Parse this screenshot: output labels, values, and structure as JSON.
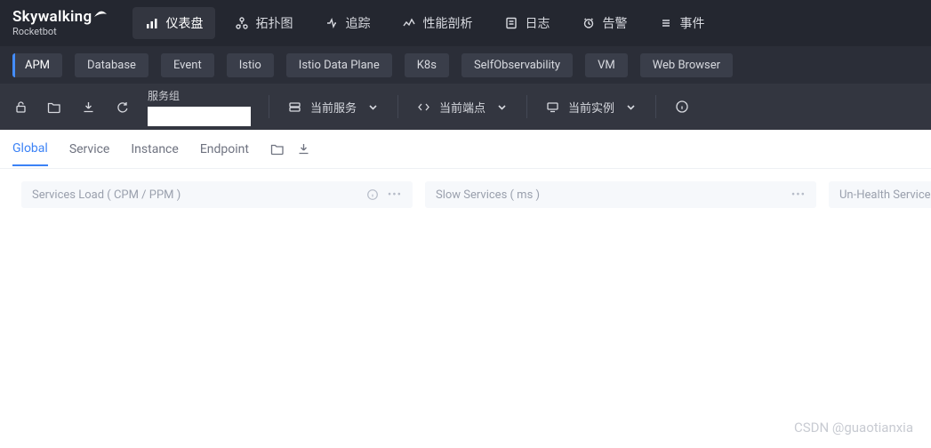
{
  "logo": {
    "main": "Skywalking",
    "sub": "Rocketbot"
  },
  "nav": {
    "items": [
      {
        "label": "仪表盘",
        "icon": "dashboard-icon"
      },
      {
        "label": "拓扑图",
        "icon": "topology-icon"
      },
      {
        "label": "追踪",
        "icon": "trace-icon"
      },
      {
        "label": "性能剖析",
        "icon": "profile-icon"
      },
      {
        "label": "日志",
        "icon": "log-icon"
      },
      {
        "label": "告警",
        "icon": "alarm-icon"
      },
      {
        "label": "事件",
        "icon": "event-icon"
      }
    ],
    "active_index": 0
  },
  "tabs": {
    "items": [
      "APM",
      "Database",
      "Event",
      "Istio",
      "Istio Data Plane",
      "K8s",
      "SelfObservability",
      "VM",
      "Web Browser"
    ],
    "active_index": 0
  },
  "selector_bar": {
    "group_label": "服务组",
    "group_value": "",
    "dropdowns": [
      {
        "label": "当前服务",
        "icon": "server-icon"
      },
      {
        "label": "当前端点",
        "icon": "code-icon"
      },
      {
        "label": "当前实例",
        "icon": "monitor-icon"
      }
    ]
  },
  "page_tabs": {
    "items": [
      "Global",
      "Service",
      "Instance",
      "Endpoint"
    ],
    "active_index": 0
  },
  "cards": [
    {
      "title": "Services Load ( CPM / PPM )",
      "has_info": true
    },
    {
      "title": "Slow Services ( ms )",
      "has_info": false
    },
    {
      "title": "Un-Health Service("
    }
  ],
  "watermark": "CSDN @guaotianxia"
}
